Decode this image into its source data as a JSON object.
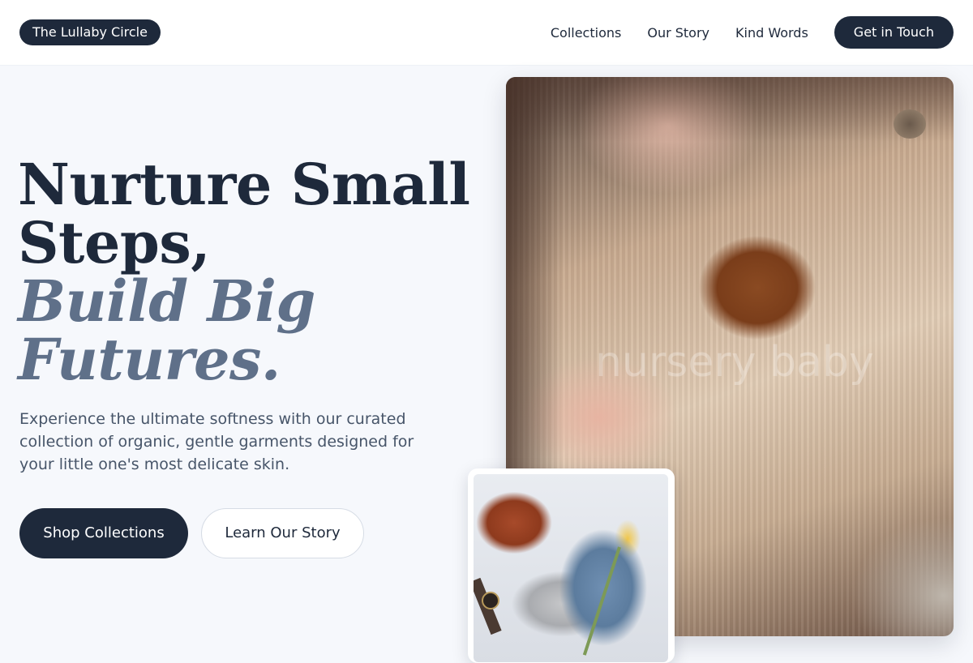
{
  "header": {
    "brand": "The Lullaby Circle",
    "nav": [
      "Collections",
      "Our Story",
      "Kind Words"
    ],
    "cta": "Get in Touch"
  },
  "hero": {
    "headline_line1": "Nurture Small",
    "headline_line2": "Steps,",
    "headline_accent1": "Build Big",
    "headline_accent2": "Futures.",
    "subtext": "Experience the ultimate softness with our curated collection of organic, gentle garments designed for your little one's most delicate skin.",
    "primary_button": "Shop Collections",
    "secondary_button": "Learn Our Story",
    "photo_watermark": "nursery baby"
  },
  "colors": {
    "primary": "#1e293b",
    "accent": "#5f7089",
    "background": "#f6f8fc"
  }
}
